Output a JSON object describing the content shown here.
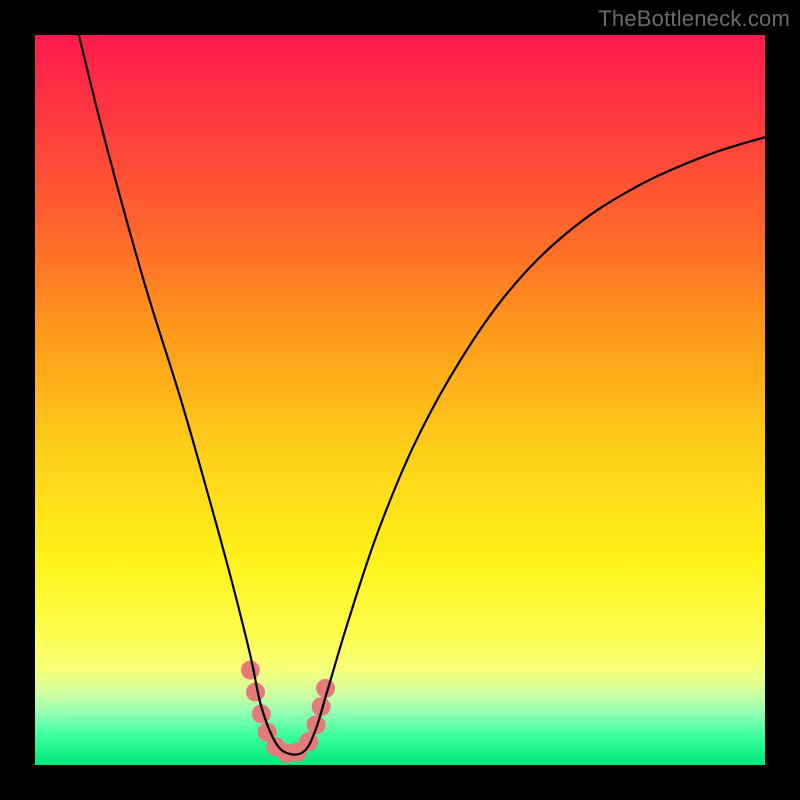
{
  "watermark": "TheBottleneck.com",
  "chart_data": {
    "type": "line",
    "title": "",
    "xlabel": "",
    "ylabel": "",
    "xlim": [
      0,
      100
    ],
    "ylim": [
      0,
      100
    ],
    "grid": false,
    "legend": false,
    "series": [
      {
        "name": "bottleneck-curve",
        "x": [
          6,
          10,
          15,
          20,
          24,
          27,
          29.5,
          31,
          33,
          35,
          37,
          38.5,
          40,
          43,
          47,
          52,
          58,
          65,
          73,
          82,
          92,
          100
        ],
        "y": [
          100,
          84,
          66,
          50,
          36,
          25,
          15,
          8,
          3,
          1.5,
          2,
          5,
          10,
          20,
          32,
          44,
          55,
          65,
          73,
          79,
          83.5,
          86
        ]
      }
    ],
    "markers": {
      "name": "highlight-segment",
      "color": "#e47a7a",
      "points": [
        {
          "x": 29.5,
          "y": 13
        },
        {
          "x": 30.2,
          "y": 10
        },
        {
          "x": 31.0,
          "y": 7
        },
        {
          "x": 31.8,
          "y": 4.5
        },
        {
          "x": 33.0,
          "y": 2.5
        },
        {
          "x": 34.5,
          "y": 1.6
        },
        {
          "x": 36.0,
          "y": 1.8
        },
        {
          "x": 37.5,
          "y": 3.2
        },
        {
          "x": 38.5,
          "y": 5.5
        },
        {
          "x": 39.2,
          "y": 8
        },
        {
          "x": 39.8,
          "y": 10.5
        }
      ]
    }
  }
}
